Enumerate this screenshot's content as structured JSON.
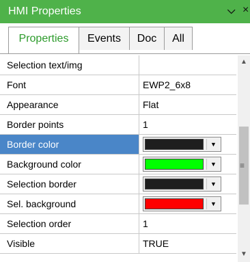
{
  "window": {
    "title": "HMI Properties",
    "pin_glyph": "⌵",
    "close_glyph": "×"
  },
  "tabs": [
    {
      "label": "Properties",
      "active": true
    },
    {
      "label": "Events",
      "active": false
    },
    {
      "label": "Doc",
      "active": false
    },
    {
      "label": "All",
      "active": false
    }
  ],
  "rows": [
    {
      "name": "Selection text/img",
      "value": ""
    },
    {
      "name": "Font",
      "value": "EWP2_6x8"
    },
    {
      "name": "Appearance",
      "value": "Flat"
    },
    {
      "name": "Border points",
      "value": "1"
    },
    {
      "name": "Border color",
      "value": "",
      "color": "#1e1e1e",
      "selected": true
    },
    {
      "name": "Background color",
      "value": "",
      "color": "#00ff00"
    },
    {
      "name": "Selection border",
      "value": "",
      "color": "#1e1e1e"
    },
    {
      "name": "Sel. background",
      "value": "",
      "color": "#ff0000"
    },
    {
      "name": "Selection order",
      "value": "1"
    },
    {
      "name": "Visible",
      "value": "TRUE"
    }
  ],
  "dropdown_glyph": "▼",
  "colors": {
    "titlebar": "#4fb24a",
    "selected_row": "#4a86c8",
    "active_tab_text": "#2c9b2b"
  }
}
